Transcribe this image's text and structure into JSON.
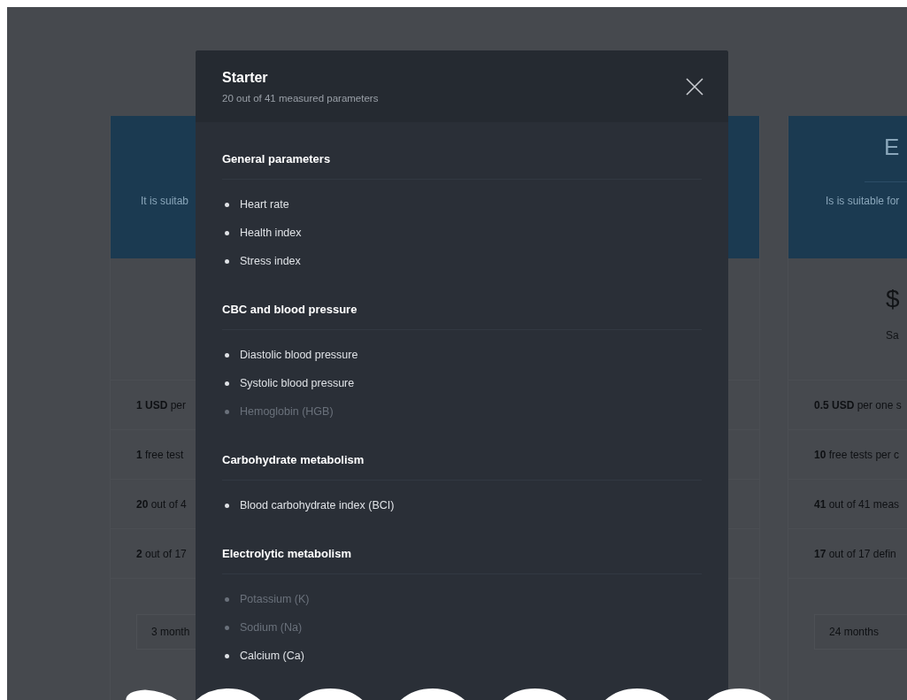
{
  "background_cards": [
    {
      "subtitle": "It is suitab",
      "features": [
        "**1 USD** per",
        "**1** free test",
        "**20** out of 4",
        "**2** out of 17"
      ],
      "period": "3 month"
    },
    {
      "title": "E",
      "subtitle": "Is is suitable for",
      "price": "$",
      "price_note": "Sa",
      "features": [
        "**0.5 USD** per one s",
        "**10** free tests per c",
        "**41** out of 41 meas",
        "**17** out of 17 defin"
      ],
      "period": "24 months"
    }
  ],
  "modal": {
    "title": "Starter",
    "subtitle": "20 out of 41 measured parameters",
    "groups": [
      {
        "title": "General parameters",
        "items": [
          {
            "label": "Heart rate",
            "included": true
          },
          {
            "label": "Health index",
            "included": true
          },
          {
            "label": "Stress index",
            "included": true
          }
        ]
      },
      {
        "title": "CBC and blood pressure",
        "items": [
          {
            "label": "Diastolic blood pressure",
            "included": true
          },
          {
            "label": "Systolic blood pressure",
            "included": true
          },
          {
            "label": "Hemoglobin (HGB)",
            "included": false
          }
        ]
      },
      {
        "title": "Carbohydrate metabolism",
        "items": [
          {
            "label": "Blood carbohydrate index (BCI)",
            "included": true
          }
        ]
      },
      {
        "title": "Electrolytic metabolism",
        "items": [
          {
            "label": "Potassium (K)",
            "included": false
          },
          {
            "label": "Sodium (Na)",
            "included": false
          },
          {
            "label": "Calcium (Ca)",
            "included": true
          }
        ]
      }
    ]
  }
}
